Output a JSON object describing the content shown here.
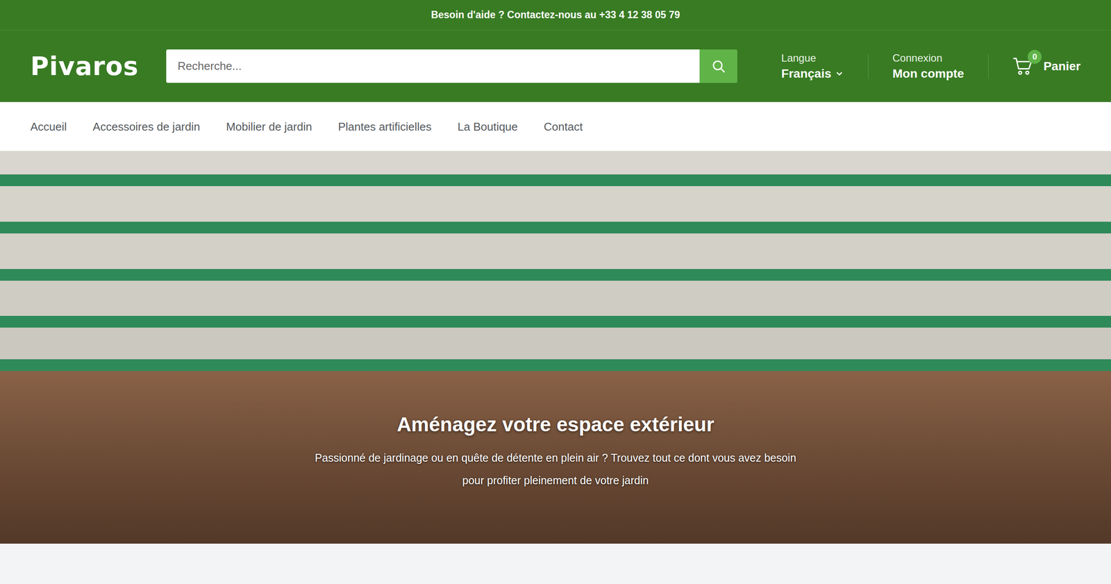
{
  "top_bar": {
    "text": "Besoin d'aide ? Contactez-nous au +33 4 12 38 05 79"
  },
  "header": {
    "logo": "Pivaros",
    "search": {
      "placeholder": "Recherche..."
    },
    "language": {
      "label": "Langue",
      "value": "Français"
    },
    "account": {
      "label": "Connexion",
      "value": "Mon compte"
    },
    "cart": {
      "count": "0",
      "label": "Panier"
    }
  },
  "nav": [
    "Accueil",
    "Accessoires de jardin",
    "Mobilier de jardin",
    "Plantes artificielles",
    "La Boutique",
    "Contact"
  ],
  "hero": {
    "title": "Aménagez votre espace extérieur",
    "text": "Passionné de jardinage ou en quête de détente en plein air ? Trouvez tout ce dont vous avez besoin pour profiter pleinement de votre jardin"
  }
}
